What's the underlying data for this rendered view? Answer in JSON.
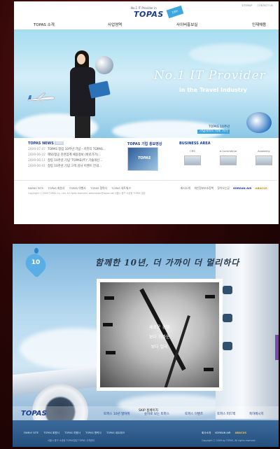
{
  "panel1": {
    "logo": {
      "slogan": "No.1 IT Provider in",
      "mark": "TOPAS",
      "ribbon": "10th"
    },
    "util_links": [
      "SITEMAP",
      "CONTACT US"
    ],
    "nav": [
      "TOPAS 소개",
      "사업영역",
      "사이버홍보실",
      "인재채용"
    ],
    "hero": {
      "headline": "No.1 IT Provider",
      "subheadline": "in the Travel Industry",
      "promo_line1": "TOPAS 10주년",
      "promo_line2": "기념사이트 바로 가기"
    },
    "news": {
      "title": "TOPAS NEWS",
      "more": "MORE",
      "items": [
        {
          "date": "2009-07-07",
          "text": "TOPAS 창립 10주년 기념 - 커뮤티 TOPAS..."
        },
        {
          "date": "2009-06-22",
          "text": "해외/항공 관련업계 채용정보 (바로가기)..."
        },
        {
          "date": "2009-06-11",
          "text": "창립 10주년 기념 'TOPAS(주)' 기술개선..."
        },
        {
          "date": "2009-06-01",
          "text": "창립 10주년 기념 고객 감사 이벤트 안내..."
        }
      ]
    },
    "promo_video": {
      "title": "TOPAS 기업 홍보영상",
      "thumb": "TOPAS"
    },
    "business": {
      "title": "BUSINESS AREA",
      "items": [
        "CRS",
        "e-Commerce",
        "Academy"
      ]
    },
    "footer": {
      "links": [
        "FAMILY SITE",
        "TOPAS 회원사",
        "TOPAS 여행사",
        "TOPAS 협력사",
        "TOPAS 네트워크"
      ],
      "copyright": "Copyright ⓒ 2009 TOPAS Co., Ltd. All rights reserved. webmaster@topas.net 서울시 중구 소공동 TOPAS 빌딩",
      "right_links": [
        "회사소개",
        "개인정보보호정책",
        "찾아오는길"
      ],
      "airline": "KOREAN AIR",
      "abacus": "ABACUS"
    }
  },
  "panel2": {
    "badge": "10",
    "slogan": "함께한 10년, 더 가까이 더 멀리하다",
    "menu": [
      "새로운 경영",
      "보다 가까운",
      "보다 멀리"
    ],
    "skip": "SKIP 홈페이지",
    "logo": "TOPAS",
    "nav": [
      "토파스 10년 발자취",
      "숫자로 보는 토파스",
      "토파스 이벤트",
      "토파스 피드백",
      "축하메시지"
    ],
    "footer": {
      "links": [
        "FAMILY SITE",
        "TOPAS 회원사",
        "TOPAS 여행사",
        "TOPAS 협력사",
        "TOPAS 네트워크"
      ],
      "copyright": "서울시 중구 소공동 TOPAS빌딩 TOPAS 고객센터",
      "right_links": [
        "회사소개",
        "KOREAN AIR",
        "ABACUS"
      ],
      "right_copyright": "Copyright ⓒ 2009 by TOPAS. All rights reserved."
    }
  }
}
